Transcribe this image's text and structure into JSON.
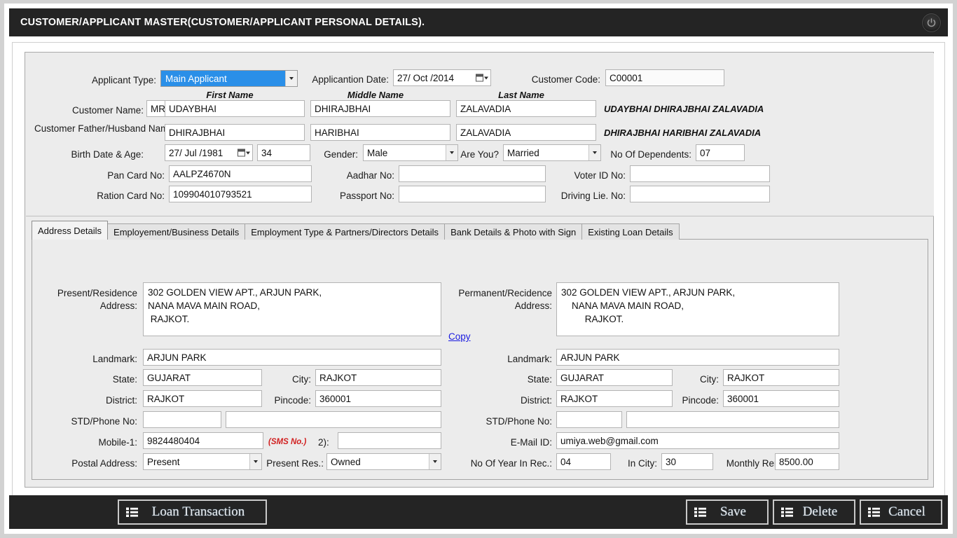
{
  "window": {
    "title": "CUSTOMER/APPLICANT MASTER(CUSTOMER/APPLICANT PERSONAL DETAILS).",
    "power_icon": "power-icon"
  },
  "colors": {
    "titlebar_bg": "#242424",
    "panel_bg": "#ececec",
    "selection_blue": "#2a8fe8",
    "link_blue": "#1a1ae0",
    "sms_red": "#d12020"
  },
  "header": {
    "applicant_type_label": "Applicant Type:",
    "applicant_type_value": "Main Applicant",
    "application_date_label": "Applicantion Date:",
    "application_date_value": "27/ Oct /2014",
    "customer_code_label": "Customer Code:",
    "customer_code_value": "C00001",
    "col_first_name": "First Name",
    "col_middle_name": "Middle Name",
    "col_last_name": "Last Name",
    "customer_name_label": "Customer Name:",
    "title_prefix_value": "MR",
    "customer_first": "UDAYBHAI",
    "customer_middle": "DHIRAJBHAI",
    "customer_last": "ZALAVADIA",
    "customer_fullname": "UDAYBHAI DHIRAJBHAI ZALAVADIA",
    "father_name_label": "Customer Father/Husband Name:",
    "father_first": "DHIRAJBHAI",
    "father_middle": "HARIBHAI",
    "father_last": "ZALAVADIA",
    "father_fullname": "DHIRAJBHAI HARIBHAI ZALAVADIA",
    "birth_label": "Birth Date & Age:",
    "birth_date": "27/ Jul /1981",
    "age": "34",
    "gender_label": "Gender:",
    "gender_value": "Male",
    "are_you_label": "Are You?",
    "are_you_value": "Married",
    "dependents_label": "No Of Dependents:",
    "dependents_value": "07",
    "pan_label": "Pan Card No:",
    "pan_value": "AALPZ4670N",
    "aadhar_label": "Aadhar No:",
    "aadhar_value": "",
    "voter_label": "Voter ID No:",
    "voter_value": "",
    "ration_label": "Ration Card No:",
    "ration_value": "109904010793521",
    "passport_label": "Passport No:",
    "passport_value": "",
    "driving_label": "Driving Lie. No:",
    "driving_value": ""
  },
  "tabs": [
    {
      "label": "Address Details",
      "active": true
    },
    {
      "label": "Employement/Business Details",
      "active": false
    },
    {
      "label": "Employment Type & Partners/Directors Details",
      "active": false
    },
    {
      "label": "Bank Details & Photo with Sign",
      "active": false
    },
    {
      "label": "Existing Loan Details",
      "active": false
    }
  ],
  "address": {
    "present": {
      "address_label_line1": "Present/Residence",
      "address_label_line2": "Address:",
      "address_value": "302 GOLDEN VIEW APT., ARJUN PARK,\nNANA MAVA MAIN ROAD,\n RAJKOT.",
      "landmark_label": "Landmark:",
      "landmark_value": "ARJUN PARK",
      "state_label": "State:",
      "state_value": "GUJARAT",
      "city_label": "City:",
      "city_value": "RAJKOT",
      "district_label": "District:",
      "district_value": "RAJKOT",
      "pincode_label": "Pincode:",
      "pincode_value": "360001",
      "std_label": "STD/Phone No:",
      "std_value": "",
      "phone_value": "",
      "mobile1_label": "Mobile-1:",
      "mobile1_value": "9824480404",
      "sms_note": "(SMS No.)",
      "mobile2_label": "2):",
      "mobile2_value": "",
      "postal_label": "Postal Address:",
      "postal_value": "Present",
      "present_res_label": "Present Res.:",
      "present_res_value": "Owned"
    },
    "permanent": {
      "address_label_line1": "Permanent/Recidence",
      "address_label_line2": "Address:",
      "copy_link": "Copy",
      "address_value": "302 GOLDEN VIEW APT., ARJUN PARK,\n    NANA MAVA MAIN ROAD,\n         RAJKOT.",
      "landmark_label": "Landmark:",
      "landmark_value": "ARJUN PARK",
      "state_label": "State:",
      "state_value": "GUJARAT",
      "city_label": "City:",
      "city_value": "RAJKOT",
      "district_label": "District:",
      "district_value": "RAJKOT",
      "pincode_label": "Pincode:",
      "pincode_value": "360001",
      "std_label": "STD/Phone No:",
      "std_value": "",
      "phone_value": "",
      "email_label": "E-Mail ID:",
      "email_value": "umiya.web@gmail.com",
      "years_rec_label": "No Of Year In Rec.:",
      "years_rec_value": "04",
      "in_city_label": "In City:",
      "in_city_value": "30",
      "monthly_rent_label": "Monthly Rent:",
      "monthly_rent_value": "8500.00"
    }
  },
  "footer": {
    "loan_transaction": "Loan Transaction",
    "save": "Save",
    "delete": "Delete",
    "cancel": "Cancel"
  }
}
